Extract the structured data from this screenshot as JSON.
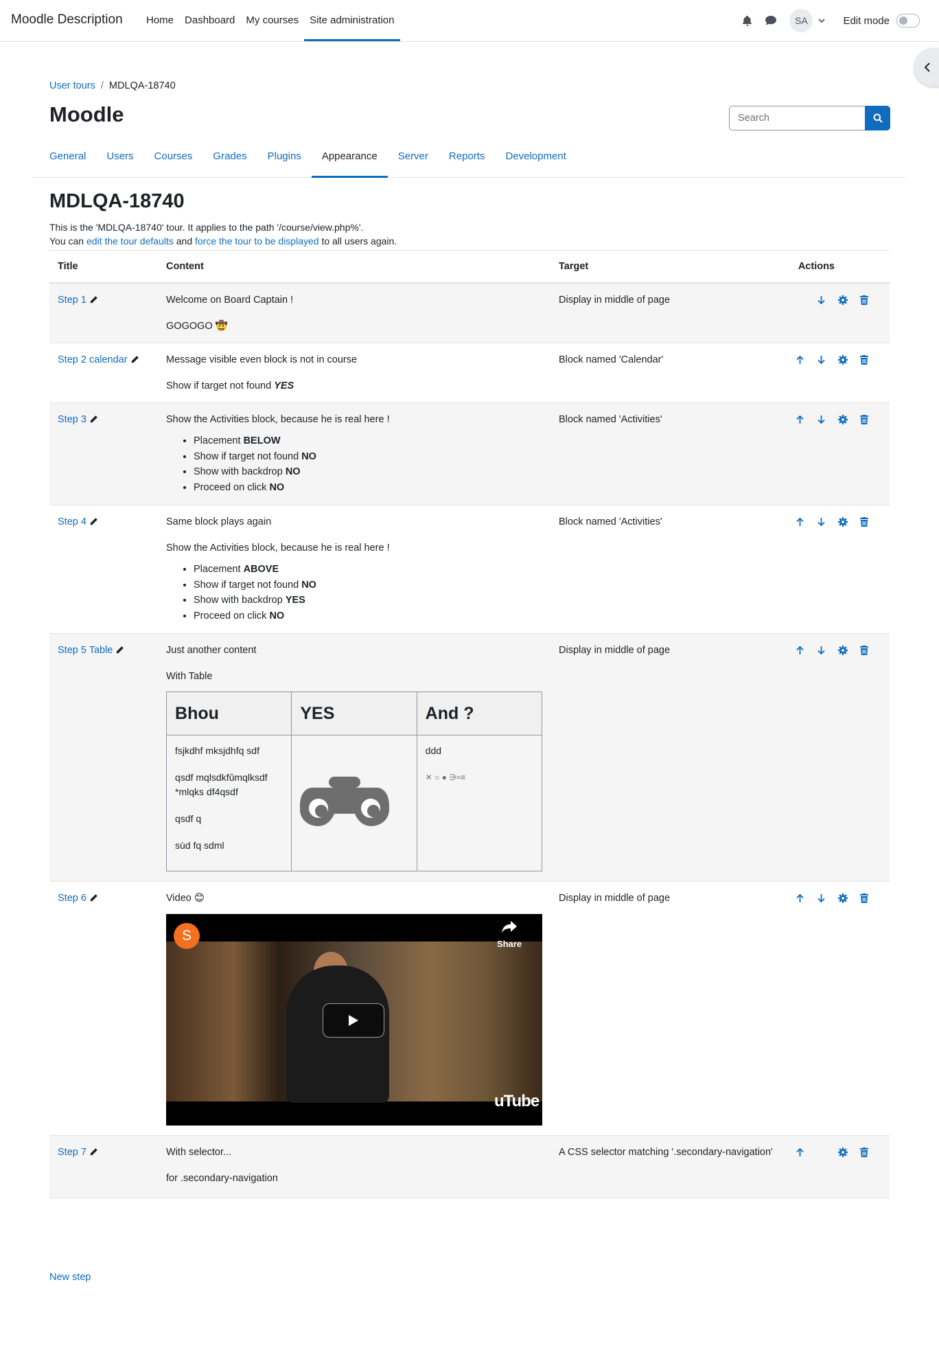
{
  "navbar": {
    "brand": "Moodle Description",
    "items": [
      "Home",
      "Dashboard",
      "My courses",
      "Site administration"
    ],
    "avatar_initials": "SA",
    "edit_mode_label": "Edit mode",
    "edit_mode_on": false
  },
  "breadcrumb": {
    "parent": "User tours",
    "separator": "/",
    "current": "MDLQA-18740"
  },
  "header": {
    "title": "Moodle"
  },
  "search": {
    "placeholder": "Search"
  },
  "secondary_nav": {
    "items": [
      "General",
      "Users",
      "Courses",
      "Grades",
      "Plugins",
      "Appearance",
      "Server",
      "Reports",
      "Development"
    ],
    "active": "Appearance"
  },
  "tour": {
    "title": "MDLQA-18740",
    "desc_line1": "This is the 'MDLQA-18740' tour. It applies to the path '/course/view.php%'.",
    "desc_line2_prefix": "You can ",
    "edit_defaults_link": "edit the tour defaults",
    "and": " and ",
    "force_link": "force the tour to be displayed",
    "desc_line2_suffix": " to all users again."
  },
  "table": {
    "headers": {
      "title": "Title",
      "content": "Content",
      "target": "Target",
      "actions": "Actions"
    },
    "steps": [
      {
        "title": "Step 1",
        "content_1": "Welcome on Board Captain !",
        "content_2": "GOGOGO",
        "emoji": "🤠",
        "target": "Display in middle of page"
      },
      {
        "title": "Step 2 calendar",
        "content_1": "Message visible even block is not in course",
        "content_2_prefix": "Show if target not found ",
        "content_2_value": "YES",
        "target": "Block named 'Calendar'"
      },
      {
        "title": "Step 3",
        "content_1": "Show the Activities block, because he is real here !",
        "bullets": [
          {
            "label": "Placement ",
            "value": "BELOW"
          },
          {
            "label": "Show if target not found ",
            "value": "NO"
          },
          {
            "label": "Show with backdrop ",
            "value": "NO"
          },
          {
            "label": "Proceed on click ",
            "value": "NO"
          }
        ],
        "target": "Block named 'Activities'"
      },
      {
        "title": "Step 4",
        "content_1": "Same block plays again",
        "content_2": "Show the Activities block, because he is real here !",
        "bullets": [
          {
            "label": "Placement ",
            "value": "ABOVE"
          },
          {
            "label": "Show if target not found ",
            "value": "NO"
          },
          {
            "label": "Show with backdrop ",
            "value": "YES"
          },
          {
            "label": "Proceed on click ",
            "value": "NO"
          }
        ],
        "target": "Block named 'Activities'"
      },
      {
        "title": "Step 5 Table",
        "content_1": "Just another content",
        "content_2": "With Table",
        "inner_table": {
          "headers": [
            "Bhou",
            "YES",
            "And ?"
          ],
          "col1": [
            "fsjkdhf mksjdhfq sdf",
            "qsdf mqlsdkfûmqlksdf *mlqks df4qsdf",
            "qsdf q",
            "sùd fq sdml"
          ],
          "col2_icon": "binoculars-icon",
          "col3": [
            "ddd",
            "✕ ○ ● ∋≈≡"
          ]
        },
        "target": "Display in middle of page"
      },
      {
        "title": "Step 6",
        "content_1": "Video",
        "emoji": "😊",
        "video": {
          "channel_initial": "S",
          "share_label": "Share",
          "brand": "uTube"
        },
        "target": "Display in middle of page"
      },
      {
        "title": "Step 7",
        "content_1": "With selector...",
        "content_2": "for .secondary-navigation",
        "target": "A CSS selector matching '.secondary-navigation'"
      }
    ]
  },
  "new_step_link": "New step",
  "colors": {
    "link": "#0f6cbf",
    "row_alt": "#f5f5f5",
    "border": "#dee2e6",
    "text": "#1d2125"
  }
}
